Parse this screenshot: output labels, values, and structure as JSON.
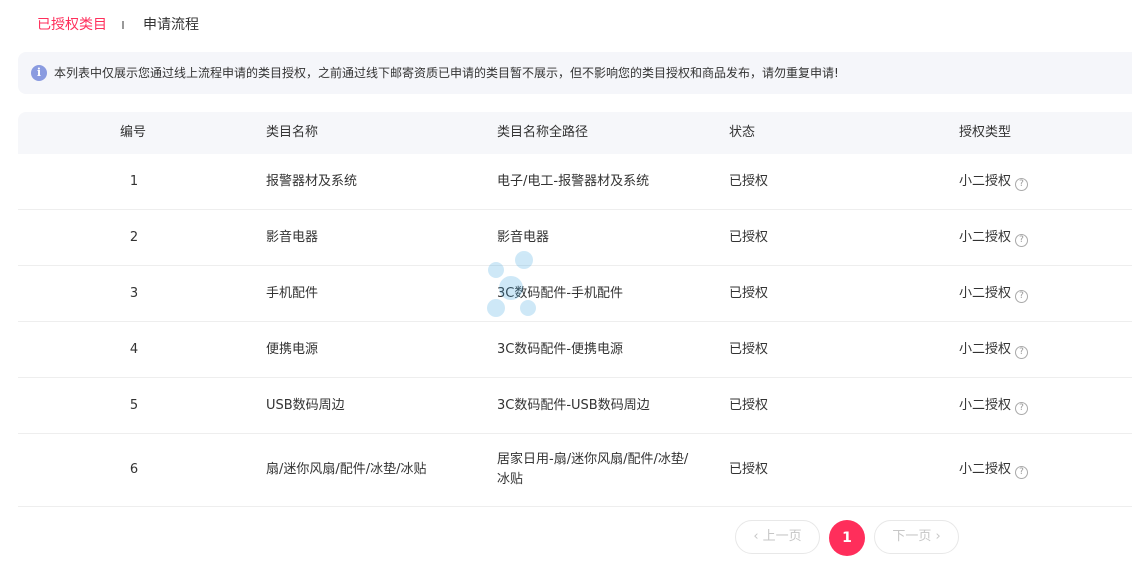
{
  "tabs": [
    {
      "label": "已授权类目"
    },
    {
      "label": "申请流程"
    }
  ],
  "notice": {
    "icon": "info-icon",
    "text": "本列表中仅展示您通过线上流程申请的类目授权，之前通过线下邮寄资质已申请的类目暂不展示，但不影响您的类目授权和商品发布，请勿重复申请!"
  },
  "table": {
    "headers": [
      "编号",
      "类目名称",
      "类目名称全路径",
      "状态",
      "授权类型"
    ],
    "rows": [
      {
        "num": "1",
        "name": "报警器材及系统",
        "path": "电子/电工-报警器材及系统",
        "status": "已授权",
        "type": "小二授权"
      },
      {
        "num": "2",
        "name": "影音电器",
        "path": "影音电器",
        "status": "已授权",
        "type": "小二授权"
      },
      {
        "num": "3",
        "name": "手机配件",
        "path": "3C数码配件-手机配件",
        "status": "已授权",
        "type": "小二授权"
      },
      {
        "num": "4",
        "name": "便携电源",
        "path": "3C数码配件-便携电源",
        "status": "已授权",
        "type": "小二授权"
      },
      {
        "num": "5",
        "name": "USB数码周边",
        "path": "3C数码配件-USB数码周边",
        "status": "已授权",
        "type": "小二授权"
      },
      {
        "num": "6",
        "name": "扇/迷你风扇/配件/冰垫/冰贴",
        "path": "居家日用-扇/迷你风扇/配件/冰垫/冰贴",
        "status": "已授权",
        "type": "小二授权"
      }
    ]
  },
  "pagination": {
    "prev": "上一页",
    "current": "1",
    "next": "下一页"
  },
  "colors": {
    "accent": "#ff2e5b",
    "notice_bg": "#f5f6fa",
    "header_bg": "#f6f7fa"
  }
}
